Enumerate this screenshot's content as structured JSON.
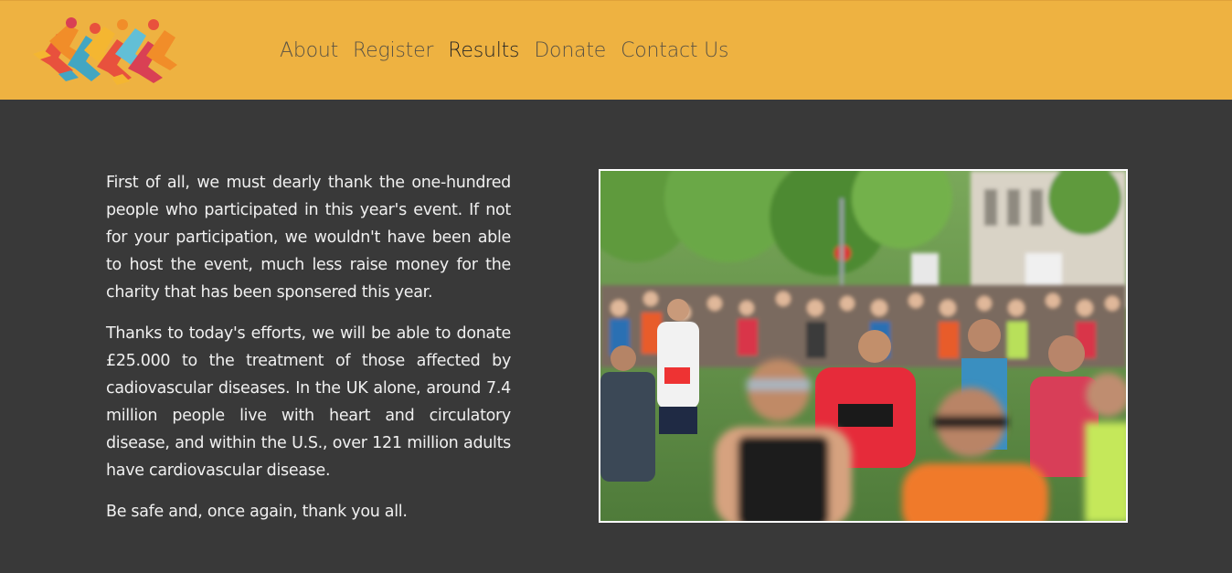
{
  "header": {
    "logo_label": "runners logo",
    "nav": [
      {
        "label": "About",
        "active": false
      },
      {
        "label": "Register",
        "active": false
      },
      {
        "label": "Results",
        "active": true
      },
      {
        "label": "Donate",
        "active": false
      },
      {
        "label": "Contact Us",
        "active": false
      }
    ]
  },
  "main": {
    "paragraphs": [
      "First of all, we must dearly thank the one-hundred people who participated in this year's event. If not for your participation, we wouldn't have been able to host the event, much less raise money for the charity that has been sponsered this year.",
      "Thanks to today's efforts, we will be able to donate £25.000 to the treatment of those affected by cadiovascular diseases. In the UK alone, around 7.4 million people live with heart and circulatory disease, and within the U.S., over 121 million adults have cardiovascular disease.",
      "Be safe and, once again, thank you all."
    ],
    "photo_alt": "marathon runners"
  },
  "colors": {
    "header_bg": "#eeb241",
    "page_bg": "#393939",
    "nav_text": "#5a5344",
    "nav_active": "#262626",
    "body_text": "#f0f0f0"
  }
}
